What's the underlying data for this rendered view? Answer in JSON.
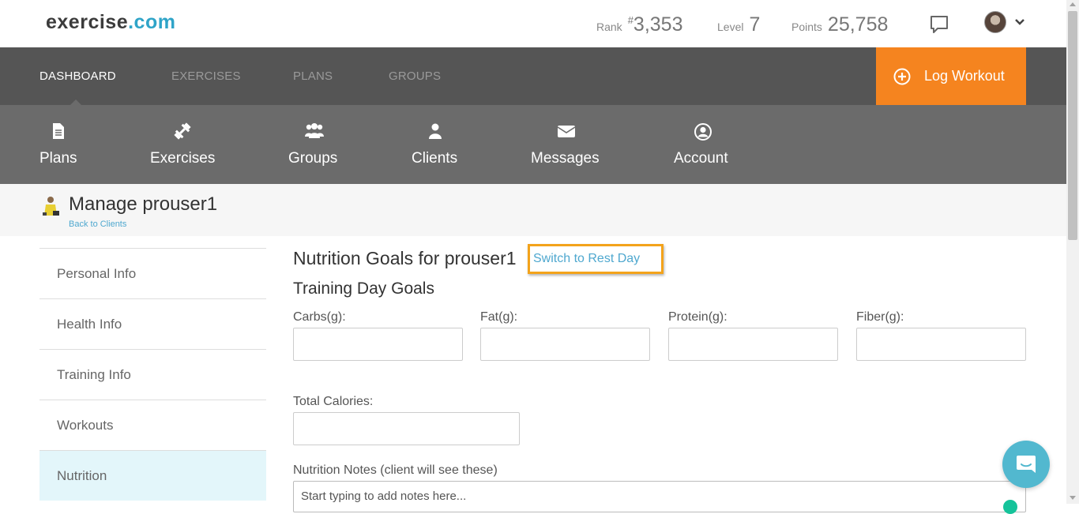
{
  "header": {
    "logo_main": "exercise",
    "logo_tld": ".com",
    "rank_label": "Rank",
    "rank_hash": "#",
    "rank_value": "3,353",
    "level_label": "Level",
    "level_value": "7",
    "points_label": "Points",
    "points_value": "25,758"
  },
  "main_nav": {
    "tabs": [
      {
        "label": "DASHBOARD",
        "active": true
      },
      {
        "label": "EXERCISES",
        "active": false
      },
      {
        "label": "PLANS",
        "active": false
      },
      {
        "label": "GROUPS",
        "active": false
      }
    ],
    "log_workout_label": "Log Workout"
  },
  "sub_nav": {
    "items": [
      {
        "label": "Plans",
        "icon": "document-icon"
      },
      {
        "label": "Exercises",
        "icon": "dumbbell-icon"
      },
      {
        "label": "Groups",
        "icon": "users-icon"
      },
      {
        "label": "Clients",
        "icon": "user-icon"
      },
      {
        "label": "Messages",
        "icon": "envelope-icon"
      },
      {
        "label": "Account",
        "icon": "user-circle-icon"
      }
    ]
  },
  "page": {
    "title": "Manage prouser1",
    "back_link": "Back to Clients"
  },
  "sidebar": {
    "items": [
      {
        "label": "Personal Info",
        "active": false
      },
      {
        "label": "Health Info",
        "active": false
      },
      {
        "label": "Training Info",
        "active": false
      },
      {
        "label": "Workouts",
        "active": false
      },
      {
        "label": "Nutrition",
        "active": true
      }
    ]
  },
  "nutrition": {
    "title": "Nutrition Goals for prouser1",
    "switch_link": "Switch to Rest Day",
    "section_title": "Training Day Goals",
    "fields": [
      {
        "label": "Carbs(g):",
        "value": ""
      },
      {
        "label": "Fat(g):",
        "value": ""
      },
      {
        "label": "Protein(g):",
        "value": ""
      },
      {
        "label": "Fiber(g):",
        "value": ""
      }
    ],
    "total_calories_label": "Total Calories:",
    "total_calories_value": "",
    "notes_label": "Nutrition Notes (client will see these)",
    "notes_placeholder": "Start typing to add notes here..."
  },
  "colors": {
    "accent_orange": "#f5841f",
    "link_blue": "#4fa8cf",
    "nav_dark": "#555555",
    "subnav_gray": "#6b6b6b",
    "highlight_border": "#f3a31b"
  }
}
